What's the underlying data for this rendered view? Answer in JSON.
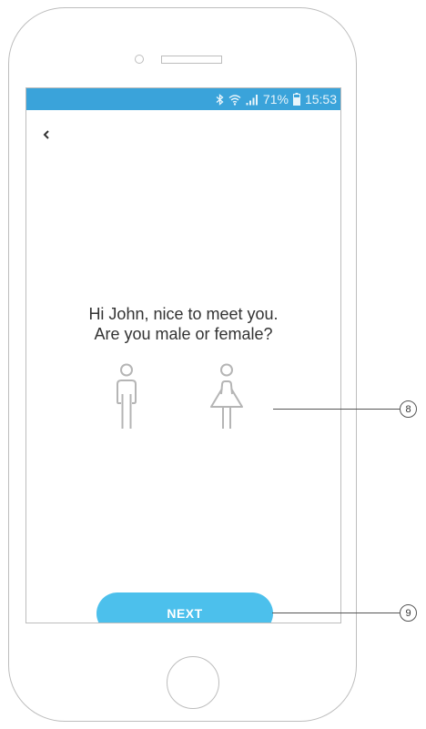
{
  "status_bar": {
    "battery": "71%",
    "time": "15:53",
    "icons": [
      "bluetooth-icon",
      "wifi-icon",
      "signal-icon",
      "battery-icon"
    ]
  },
  "screen": {
    "back_icon": "chevron-left-icon",
    "question_line1": "Hi John, nice to meet you.",
    "question_line2": "Are you male or female?",
    "gender_options": [
      "male-figure-icon",
      "female-figure-icon"
    ],
    "next_label": "NEXT"
  },
  "annotations": {
    "gender_marker": "8",
    "next_marker": "9"
  },
  "colors": {
    "status_bar": "#3aa3da",
    "button": "#4cc0ec",
    "icon_stroke": "#b5b5b5",
    "text": "#333333"
  }
}
